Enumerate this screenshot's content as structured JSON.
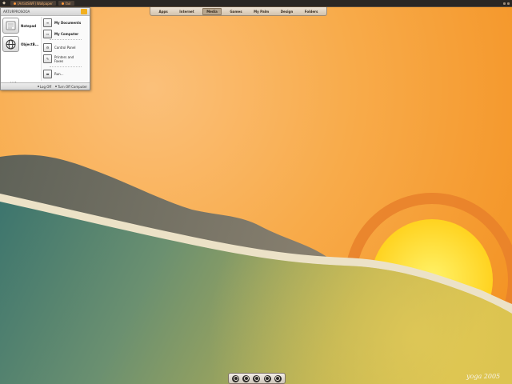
{
  "taskbar": {
    "tasks": [
      {
        "label": "[ArtistSWF] Wallpaper"
      },
      {
        "label": "fair"
      }
    ]
  },
  "start_menu": {
    "user_name": "ARTURPROSOOA",
    "pinned": [
      {
        "label": "Notepad",
        "icon": "notepad-icon"
      },
      {
        "label": "ObjectB...",
        "icon": "globe-icon"
      }
    ],
    "all_programs": "All Programs",
    "places": [
      {
        "label": "My Documents",
        "icon": "document-icon"
      },
      {
        "label": "My Computer",
        "icon": "computer-icon"
      },
      {
        "label": "Control Panel",
        "icon": "control-panel-icon"
      },
      {
        "label": "Printers and Faxes",
        "icon": "printer-icon"
      },
      {
        "label": "Run...",
        "icon": "run-icon"
      }
    ],
    "footer": {
      "log_off": "Log Off",
      "turn_off": "Turn Off Computer"
    }
  },
  "top_dock": {
    "items": [
      "Apps",
      "Internet",
      "Media",
      "Games",
      "My Palm",
      "Design",
      "Folders"
    ],
    "active": "Media"
  },
  "quick_bar": {
    "icons": [
      "quick-icon-1",
      "quick-icon-2",
      "quick-icon-3",
      "quick-icon-4",
      "quick-icon-5"
    ]
  },
  "signature": "yoga 2005",
  "colors": {
    "sky_top": "#f4972a",
    "sky_light": "#fbc07a",
    "sun": "#ffe23a",
    "sea_teal": "#3f7c78",
    "sea_olive": "#a8a85a",
    "hill": "#7c7566"
  }
}
